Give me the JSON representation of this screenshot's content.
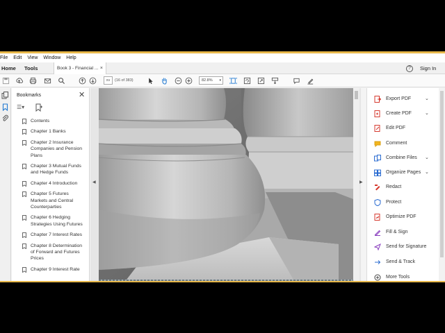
{
  "menubar": {
    "items": [
      "File",
      "Edit",
      "View",
      "Window",
      "Help"
    ]
  },
  "tabbar": {
    "home": "Home",
    "tools": "Tools",
    "doc_tab": "Book 3 - Financial ...",
    "close_glyph": "×",
    "help_glyph": "?",
    "signin": "Sign In"
  },
  "toolbar": {
    "page_input": "xv",
    "page_count": "(16 of 383)",
    "zoom": "82.8%",
    "zoom_arrow": "▾"
  },
  "bookmarks": {
    "title": "Bookmarks",
    "close_glyph": "✕",
    "options_glyph": "☰▾",
    "items": [
      "Contents",
      "Chapter 1 Banks",
      "Chapter 2 Insurance Companies and Pension Plans",
      "Chapter 3 Mutual Funds and Hedge Funds",
      "Chapter 4 Introduction",
      "Chapter 5 Futures Markets and Central Counterparties",
      "Chapter 6 Hedging Strategies Using Futures",
      "Chapter 7 Interest Rates",
      "Chapter 8 Determination of Forward and Futures Prices",
      "Chapter 9 Interest Rate"
    ]
  },
  "docarea": {
    "left_arrow": "◀",
    "right_arrow": "▶"
  },
  "tools_panel": {
    "items": [
      {
        "label": "Export PDF",
        "color": "#d63a2f",
        "chevron": true
      },
      {
        "label": "Create PDF",
        "color": "#d63a2f",
        "chevron": true
      },
      {
        "label": "Edit PDF",
        "color": "#d63a2f",
        "chevron": false
      },
      {
        "label": "Comment",
        "color": "#f2b51f",
        "chevron": false
      },
      {
        "label": "Combine Files",
        "color": "#2a6bd1",
        "chevron": true
      },
      {
        "label": "Organize Pages",
        "color": "#2a6bd1",
        "chevron": true
      },
      {
        "label": "Redact",
        "color": "#d63a2f",
        "chevron": false
      },
      {
        "label": "Protect",
        "color": "#2a6bd1",
        "chevron": false
      },
      {
        "label": "Optimize PDF",
        "color": "#d63a2f",
        "chevron": false
      },
      {
        "label": "Fill & Sign",
        "color": "#8a3fbf",
        "chevron": false
      },
      {
        "label": "Send for Signature",
        "color": "#8a3fbf",
        "chevron": false
      },
      {
        "label": "Send & Track",
        "color": "#2a6bd1",
        "chevron": false
      },
      {
        "label": "More Tools",
        "color": "#444444",
        "chevron": false
      }
    ],
    "chevron_glyph": "⌄"
  }
}
